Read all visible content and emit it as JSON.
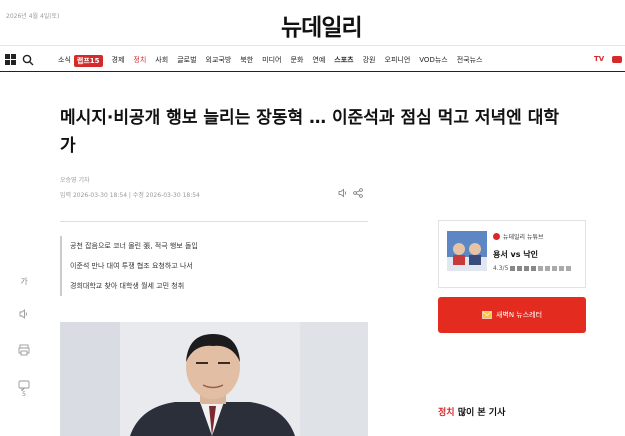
{
  "header": {
    "date": "2026년 4월 4일(토)",
    "logo": "뉴데일리"
  },
  "nav": {
    "items": [
      "소식",
      "경제",
      "정치",
      "사회",
      "글로벌",
      "외교국방",
      "북한",
      "미디어",
      "문화",
      "연예",
      "스포츠",
      "강원",
      "오피니언",
      "VOD뉴스",
      "전국뉴스"
    ],
    "badge": "랩프15",
    "tv": "TV"
  },
  "article": {
    "headline": "메시지·비공개 행보 늘리는 장동혁 … 이준석과 점심 먹고 저녁엔 대학가",
    "byline": "오승영 기자",
    "dates": "입력 2026-03-30 18:54 | 수정 2026-03-30 18:54",
    "summary": [
      "공천 잡음으로 코너 몰린 張, 적극 행보 돌입",
      "이준석 만나 대여 투쟁 협조 요청하고 나서",
      "경희대학교 찾아 대학생 월세 고민 청취"
    ]
  },
  "side_tools": {
    "font": "가",
    "comment_count": "5"
  },
  "promo": {
    "brand": "뉴데일리 뉴튜브",
    "title": "용서 vs 낙인",
    "rating": "4.3/5"
  },
  "newsletter": {
    "label": "새벽N 뉴스레터"
  },
  "popular": {
    "category": "정치",
    "label": "많이 본 기사"
  },
  "colors": {
    "accent": "#d62a2a",
    "button": "#e32b20"
  }
}
